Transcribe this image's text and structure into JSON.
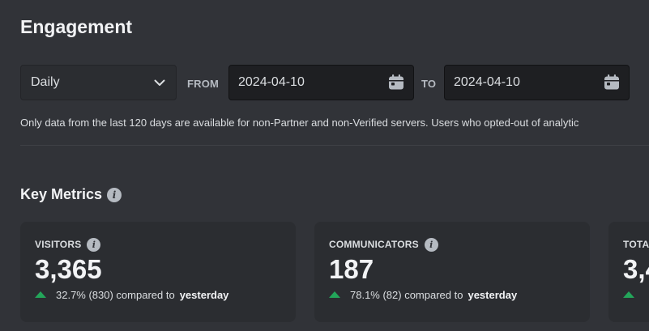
{
  "page": {
    "title": "Engagement"
  },
  "filters": {
    "interval": {
      "selected": "Daily",
      "icon": "chevron-down-icon"
    },
    "from_label": "FROM",
    "from_value": "2024-04-10",
    "to_label": "TO",
    "to_value": "2024-04-10",
    "calendar_icon": "calendar-icon"
  },
  "note": "Only data from the last 120 days are available for non-Partner and non-Verified servers. Users who opted-out of analytic",
  "key_metrics": {
    "title": "Key Metrics",
    "info_icon": "info-icon",
    "cards": [
      {
        "label": "VISITORS",
        "value": "3,365",
        "change": "32.7% (830) compared to",
        "period": "yesterday",
        "trend": "up"
      },
      {
        "label": "COMMUNICATORS",
        "value": "187",
        "change": "78.1% (82) compared to",
        "period": "yesterday",
        "trend": "up"
      },
      {
        "label": "TOTA",
        "value": "3,4",
        "change": "",
        "period": "",
        "trend": "up"
      }
    ]
  },
  "colors": {
    "background": "#313338",
    "card": "#2b2d31",
    "input": "#1e1f22",
    "positive": "#23a55a"
  }
}
